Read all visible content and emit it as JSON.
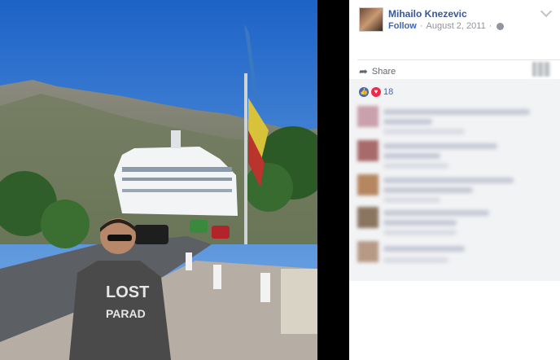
{
  "post": {
    "author": "Mihailo Knezevic",
    "follow_label": "Follow",
    "date": "August 2, 2011",
    "share_label": "Share",
    "reaction_count": "18"
  },
  "icons": {
    "like": "thumbs-up-icon",
    "love": "heart-icon",
    "privacy": "globe-icon",
    "share": "share-arrow-icon",
    "menu": "chevron-down-icon"
  },
  "colors": {
    "link": "#365899",
    "follow": "#4267b2",
    "meta": "#90949c",
    "like": "#4267b2",
    "love": "#f0284a"
  }
}
